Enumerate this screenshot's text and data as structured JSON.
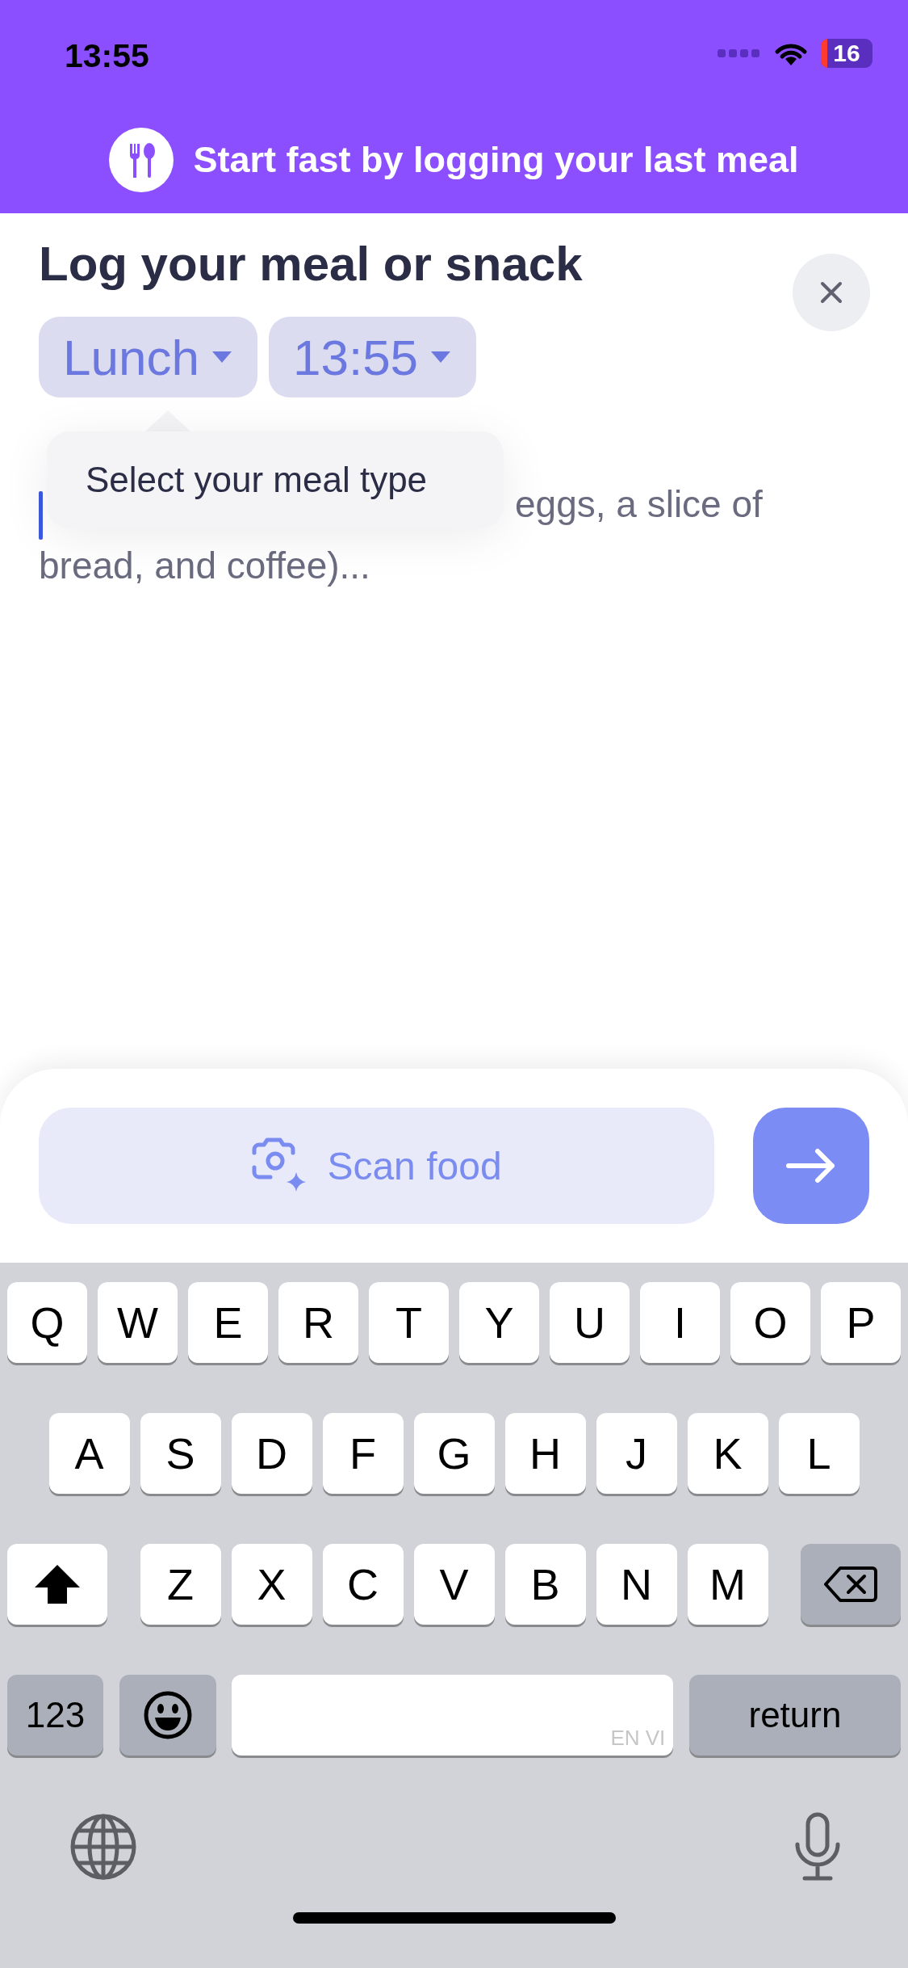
{
  "status_bar": {
    "time": "13:55",
    "battery": "16"
  },
  "banner": {
    "text": "Start fast by logging your last meal"
  },
  "title": "Log your meal or snack",
  "chips": [
    {
      "label": "Lunch"
    },
    {
      "label": "13:55"
    }
  ],
  "tooltip": {
    "text": "Select your meal type"
  },
  "meal_field": {
    "placeholder": "eggs, a slice of bread, and coffee)..."
  },
  "scan_button": {
    "label": "Scan food"
  },
  "keyboard": {
    "rows": [
      [
        "Q",
        "W",
        "E",
        "R",
        "T",
        "Y",
        "U",
        "I",
        "O",
        "P"
      ],
      [
        "A",
        "S",
        "D",
        "F",
        "G",
        "H",
        "J",
        "K",
        "L"
      ],
      [
        "Z",
        "X",
        "C",
        "V",
        "B",
        "N",
        "M"
      ]
    ],
    "number_key": "123",
    "space_languages": "EN VI",
    "return_key": "return"
  }
}
